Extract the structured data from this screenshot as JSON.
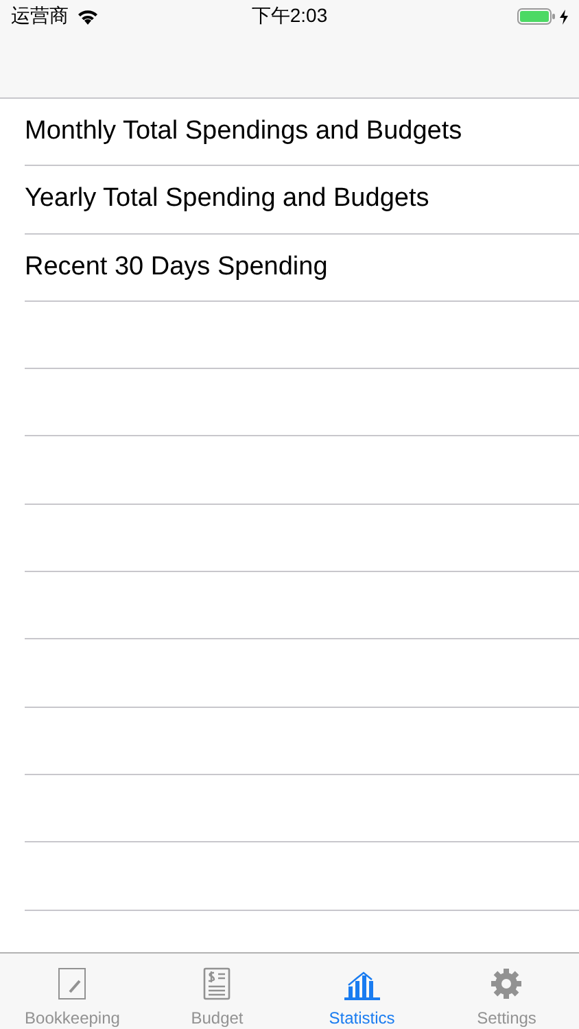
{
  "status_bar": {
    "carrier": "运营商",
    "time": "下午2:03"
  },
  "list": {
    "items": [
      "Monthly Total Spendings and Budgets",
      "Yearly Total Spending and Budgets",
      "Recent 30 Days Spending"
    ]
  },
  "tab_bar": {
    "tabs": [
      {
        "label": "Bookkeeping",
        "kind": "note",
        "selected": false
      },
      {
        "label": "Budget",
        "kind": "ledger",
        "selected": false
      },
      {
        "label": "Statistics",
        "kind": "chart",
        "selected": true
      },
      {
        "label": "Settings",
        "kind": "gear",
        "selected": false
      }
    ]
  }
}
